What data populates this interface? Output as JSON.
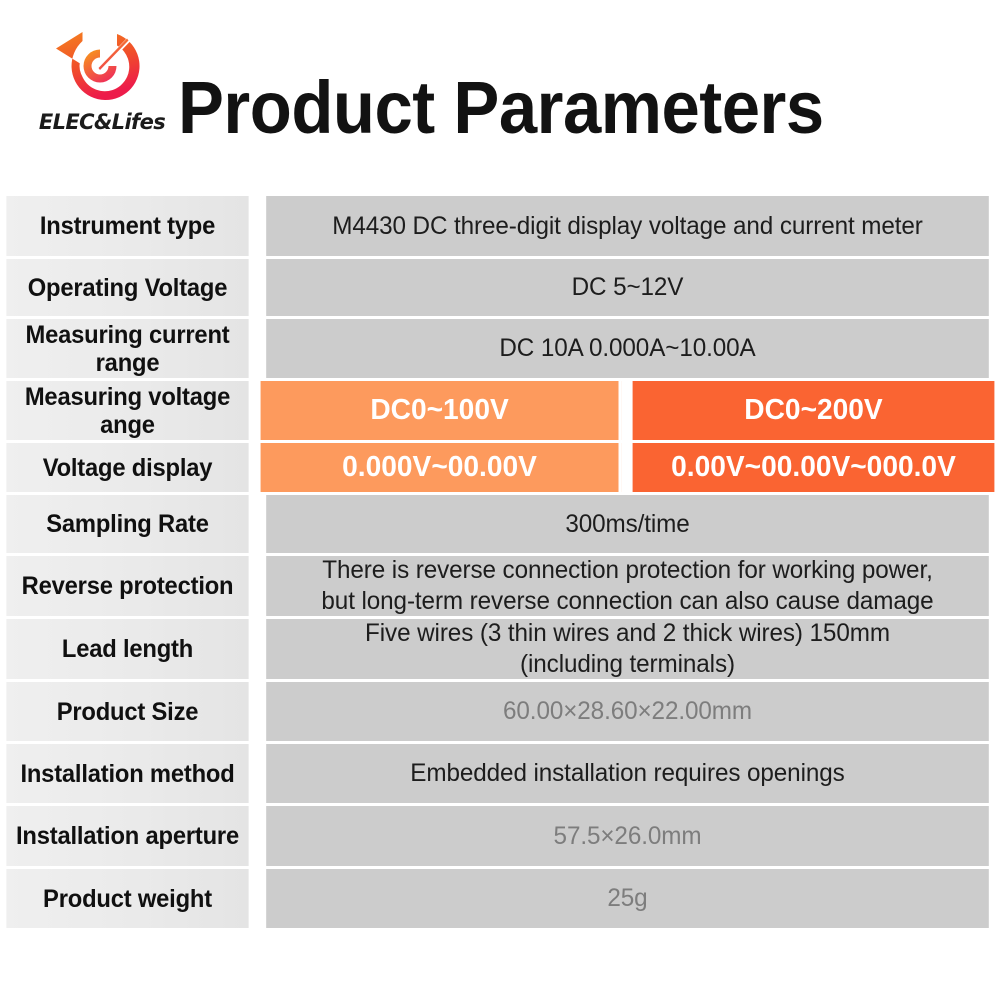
{
  "brand": {
    "name": "ELEC&Lifes",
    "logo_icon": "elec-lifes-circular-arrow-logo",
    "accent_orange_light": "#FD9A5D",
    "accent_orange_dark": "#FA6432",
    "logo_gradient_start": "#F5821F",
    "logo_gradient_end": "#ED1C4A"
  },
  "header": {
    "title": "Product Parameters"
  },
  "watermark": {
    "text": "ELEC&Lifes",
    "icon": "elec-lifes-circular-arrow-logo"
  },
  "table": {
    "colors": {
      "label_background": "#EAEAEA",
      "value_background": "#CCCCCC",
      "orange_left": "#FD9A5D",
      "orange_right": "#FA6432",
      "separator": "#FFFFFF"
    },
    "rows": [
      {
        "label": "Instrument type",
        "value": "M4430 DC three-digit display voltage and current meter",
        "style": "normal"
      },
      {
        "label": "Operating Voltage",
        "value": "DC  5~12V",
        "style": "normal"
      },
      {
        "label": "Measuring current range",
        "value": "DC 10A  0.000A~10.00A",
        "style": "normal"
      },
      {
        "label": "Measuring voltage ange",
        "value_left": "DC0~100V",
        "value_right": "DC0~200V",
        "style": "split-orange"
      },
      {
        "label": "Voltage display",
        "value_left": "0.000V~00.00V",
        "value_right": "0.00V~00.00V~000.0V",
        "style": "split-orange"
      },
      {
        "label": "Sampling Rate",
        "value": "300ms/time",
        "style": "normal"
      },
      {
        "label": "Reverse protection",
        "value_line1": "There is reverse connection protection for working power,",
        "value_line2": "but long-term reverse connection can also cause damage",
        "style": "two-line"
      },
      {
        "label": "Lead length",
        "value_line1": "Five wires (3 thin wires and 2 thick wires) 150mm",
        "value_line2": "(including terminals)",
        "style": "two-line"
      },
      {
        "label": "Product Size",
        "value": "60.00×28.60×22.00mm",
        "style": "dim"
      },
      {
        "label": "Installation method",
        "value": "Embedded installation requires openings",
        "style": "normal"
      },
      {
        "label": "Installation aperture",
        "value": "57.5×26.0mm",
        "style": "dim"
      },
      {
        "label": "Product weight",
        "value": "25g",
        "style": "dim"
      }
    ]
  }
}
